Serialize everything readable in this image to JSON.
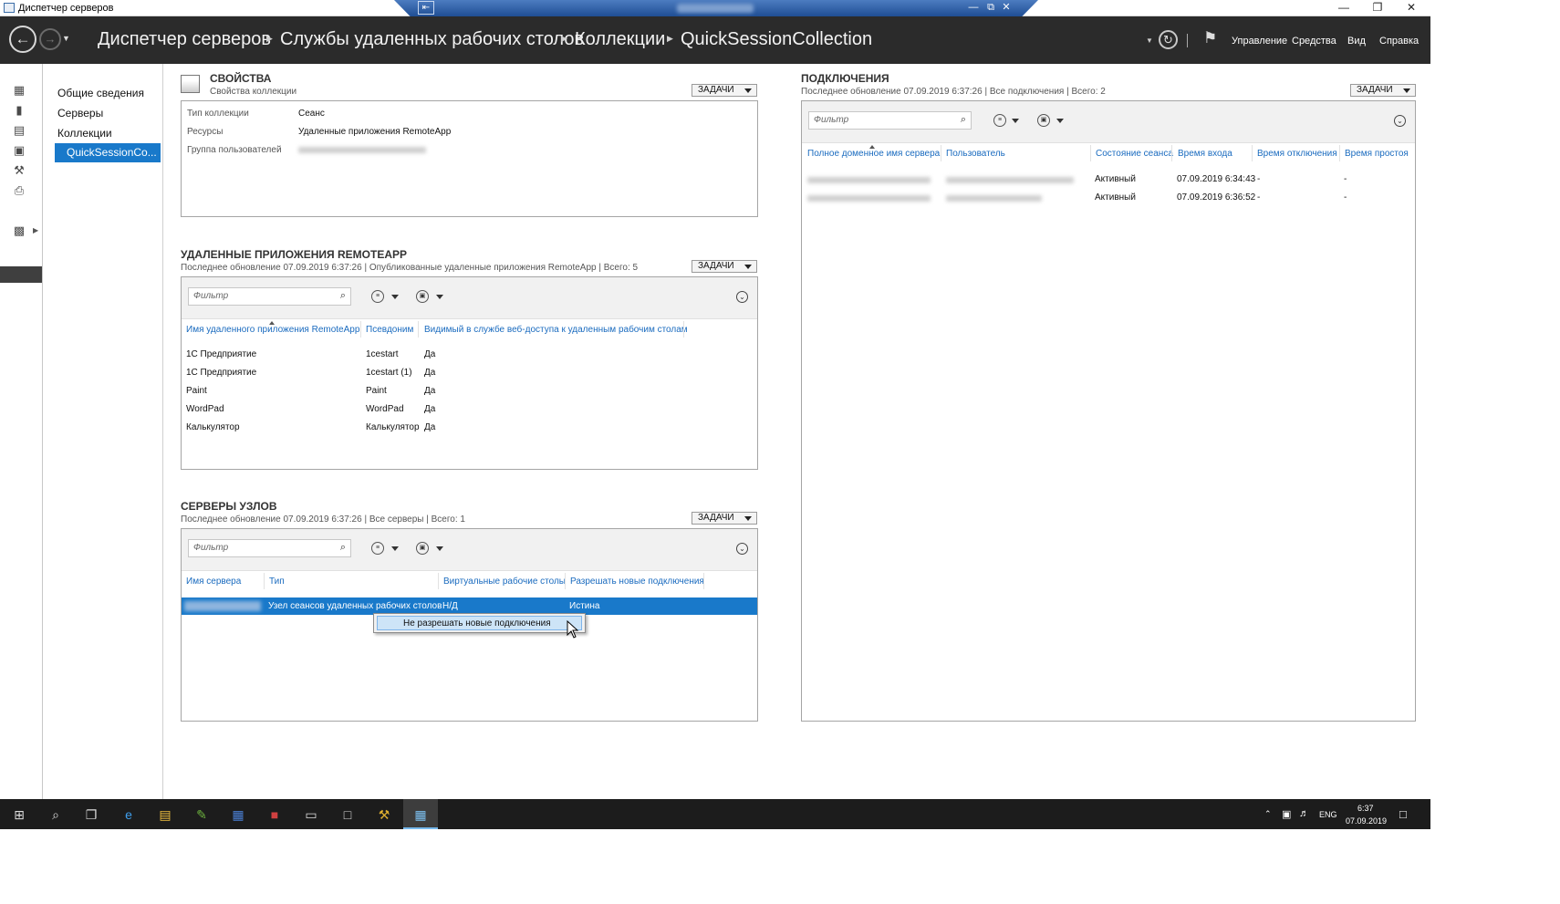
{
  "window": {
    "title": "Диспетчер серверов",
    "controls": [
      "—",
      "❐",
      "✕"
    ]
  },
  "rdp_bar": {
    "pin": "⇤",
    "controls": [
      "—",
      "⧉",
      "✕"
    ]
  },
  "header": {
    "breadcrumb": [
      "Диспетчер серверов",
      "Службы удаленных рабочих столов",
      "Коллекции",
      "QuickSessionCollection"
    ],
    "menu": [
      "Управление",
      "Средства",
      "Вид",
      "Справка"
    ]
  },
  "nav": {
    "items": [
      "Общие сведения",
      "Серверы",
      "Коллекции"
    ],
    "selected": "QuickSessionCo..."
  },
  "properties": {
    "title": "СВОЙСТВА",
    "subtitle": "Свойства коллекции",
    "tasks": "ЗАДАЧИ",
    "rows": [
      {
        "label": "Тип коллекции",
        "value": "Сеанс"
      },
      {
        "label": "Ресурсы",
        "value": "Удаленные приложения RemoteApp"
      },
      {
        "label": "Группа пользователей",
        "value": ""
      }
    ]
  },
  "remoteapp": {
    "title": "УДАЛЕННЫЕ ПРИЛОЖЕНИЯ REMOTEAPP",
    "subtitle": "Последнее обновление 07.09.2019 6:37:26 | Опубликованные удаленные приложения RemoteApp  | Всего: 5",
    "tasks": "ЗАДАЧИ",
    "filter": "Фильтр",
    "columns": [
      "Имя удаленного приложения RemoteApp",
      "Псевдоним",
      "Видимый в службе веб-доступа к удаленным рабочим столам"
    ],
    "rows": [
      [
        "1С Предприятие",
        "1cestart",
        "Да"
      ],
      [
        "1С Предприятие",
        "1cestart (1)",
        "Да"
      ],
      [
        "Paint",
        "Paint",
        "Да"
      ],
      [
        "WordPad",
        "WordPad",
        "Да"
      ],
      [
        "Калькулятор",
        "Калькулятор",
        "Да"
      ]
    ]
  },
  "hosts": {
    "title": "СЕРВЕРЫ УЗЛОВ",
    "subtitle": "Последнее обновление 07.09.2019 6:37:26 | Все серверы  | Всего: 1",
    "tasks": "ЗАДАЧИ",
    "filter": "Фильтр",
    "columns": [
      "Имя сервера",
      "Тип",
      "Виртуальные рабочие столы",
      "Разрешать новые подключения"
    ],
    "row": {
      "type": "Узел сеансов удаленных рабочих столов",
      "vdi": "Н/Д",
      "allow": "Истина"
    },
    "context_menu": "Не разрешать новые подключения"
  },
  "connections": {
    "title": "ПОДКЛЮЧЕНИЯ",
    "subtitle": "Последнее обновление 07.09.2019 6:37:26 | Все подключения  | Всего: 2",
    "tasks": "ЗАДАЧИ",
    "filter": "Фильтр",
    "columns": [
      "Полное доменное имя сервера",
      "Пользователь",
      "Состояние сеанса",
      "Время входа",
      "Время отключения",
      "Время простоя"
    ],
    "rows": [
      {
        "state": "Активный",
        "logon": "07.09.2019 6:34:43",
        "disc": "-",
        "idle": "-"
      },
      {
        "state": "Активный",
        "logon": "07.09.2019 6:36:52",
        "disc": "-",
        "idle": "-"
      }
    ]
  },
  "taskbar": {
    "lang": "ENG",
    "time": "6:37",
    "date": "07.09.2019"
  },
  "colors": {
    "accent": "#1979ca",
    "header": "#2b2b2b",
    "link": "#1a6bbf",
    "taskbar": "#1c1c1c"
  }
}
